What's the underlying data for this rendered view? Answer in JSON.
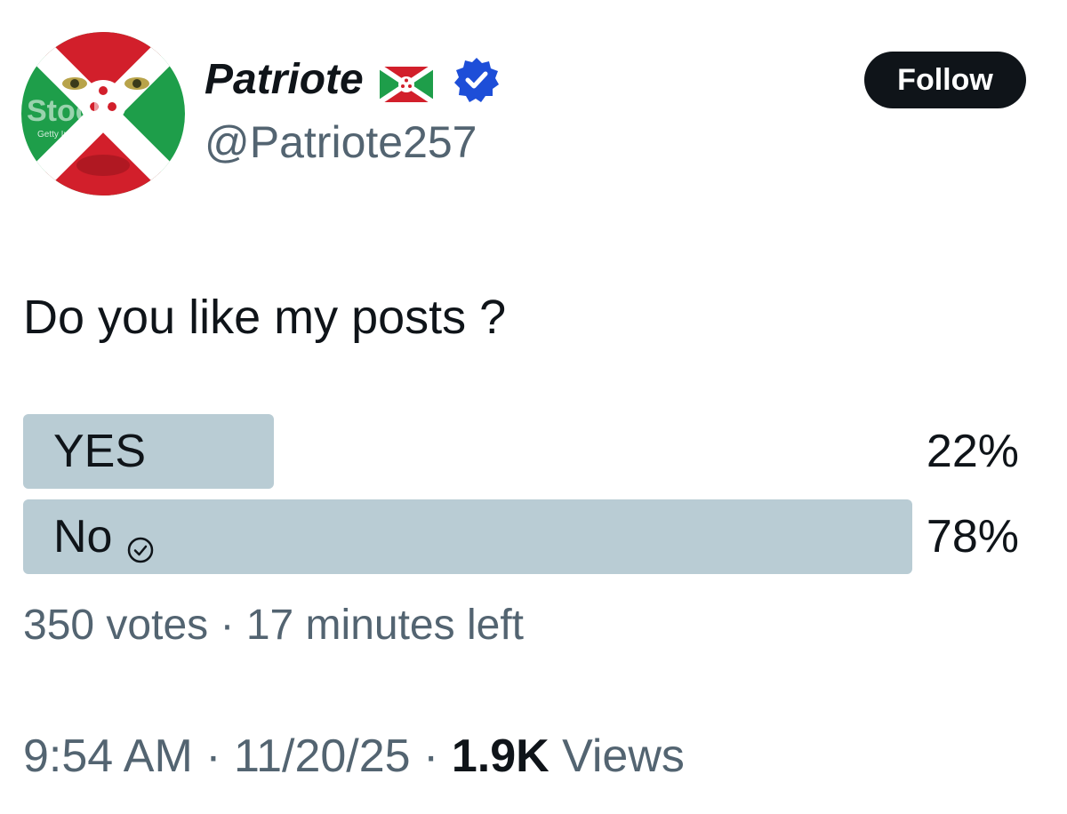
{
  "author": {
    "display_name": "Patriote",
    "handle": "@Patriote257",
    "flag_icon": "burundi-flag-icon",
    "verified_icon": "verified-badge-icon",
    "verified_color": "#1d9bf0",
    "avatar_watermark": "Getty Images"
  },
  "follow_label": "Follow",
  "post": {
    "text": "Do you like my posts ?"
  },
  "poll": {
    "options": [
      {
        "label": "YES",
        "percent_label": "22%",
        "percent": 22,
        "selected": false
      },
      {
        "label": "No",
        "percent_label": "78%",
        "percent": 78,
        "selected": true,
        "icon": "check-circle-icon"
      }
    ],
    "votes": "350 votes",
    "separator": "·",
    "time_left": "17 minutes left",
    "bar_color": "#b9ccd4"
  },
  "meta": {
    "time": "9:54 AM",
    "date": "11/20/25",
    "separator": "·",
    "views_count": "1.9K",
    "views_label": "Views"
  }
}
